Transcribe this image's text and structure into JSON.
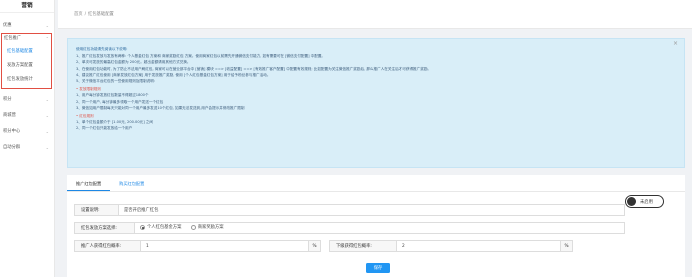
{
  "sidebar": {
    "title": "营销",
    "items": [
      {
        "label": "优惠"
      },
      {
        "label": "红包推广"
      },
      {
        "label": "红包基础配置"
      },
      {
        "label": "发放方案配置"
      },
      {
        "label": "红包发放统计"
      },
      {
        "label": "积分"
      },
      {
        "label": "商城营"
      },
      {
        "label": "积分中心"
      },
      {
        "label": "自动分群"
      }
    ]
  },
  "breadcrumb": {
    "home": "首页",
    "sep": "/",
    "current": "红包基础配置"
  },
  "notice": {
    "heading": "使用红包功能请先阅读以下说明:",
    "lines": [
      "1、推广红包发放与发放有两种: 个人基金红包 方案和 商家奖励红包 方案。使用商家红包以前需先开通微信支付能力, 如有需要可在 [微信支付配置] 中配置。",
      "2、单次可发放的最高红包金额为 200元。超出金额请用其他方式兑换。",
      "3、在使用红包功能时, 为了防止不法用户刷红包, 商家可以在营业部平台中 [营销] 模块 ==> [收益配置] ==> [有效推广客户配置] 中配置有效规则; 比如配置为关注微信推广奖励后, 那么推广人在关注后才可获得推广奖励。",
      "4、建议推广红包使用 [商家发放红包方案] 用于发放推广奖励, 使用 [个人红包基金红包方案] 用于给予粉丝参与推广活动。",
      "5、关于微信平台红包的一些使用规则及限制说明:"
    ],
    "section1": "• 发放限制规则",
    "rules1": [
      "1、用户每分钟发放红包数量不得超过1800个",
      "2、同一个用户, 每分钟最多领取一个用户发送一个红包",
      "3、微信如用户限制每天只能对同一个用户最多发送10个红包, 如果无法发送到,用户会提示并修改推广限制"
    ],
    "section2": "• 红包规则",
    "rules2": [
      "1、单个红包金额介于 [1.00元, 200.00元] 之间",
      "2、同一个红包只能发放给一个用户"
    ]
  },
  "tabs": [
    {
      "label": "推广红包配置"
    },
    {
      "label": "购买红包配置"
    }
  ],
  "form": {
    "setting_label": "设置说明:",
    "setting_value": "是否开启推广红包",
    "toggle_label": "未启用",
    "plan_label": "红包发放方案选择:",
    "plan_options": [
      "个人红包基金方案",
      "商家奖励方案"
    ],
    "promoter_rate_label": "推广人获得红包概率:",
    "promoter_rate_value": "1",
    "downline_rate_label": "下级获得红包概率:",
    "downline_rate_value": "2",
    "unit": "%",
    "save_label": "保存"
  }
}
